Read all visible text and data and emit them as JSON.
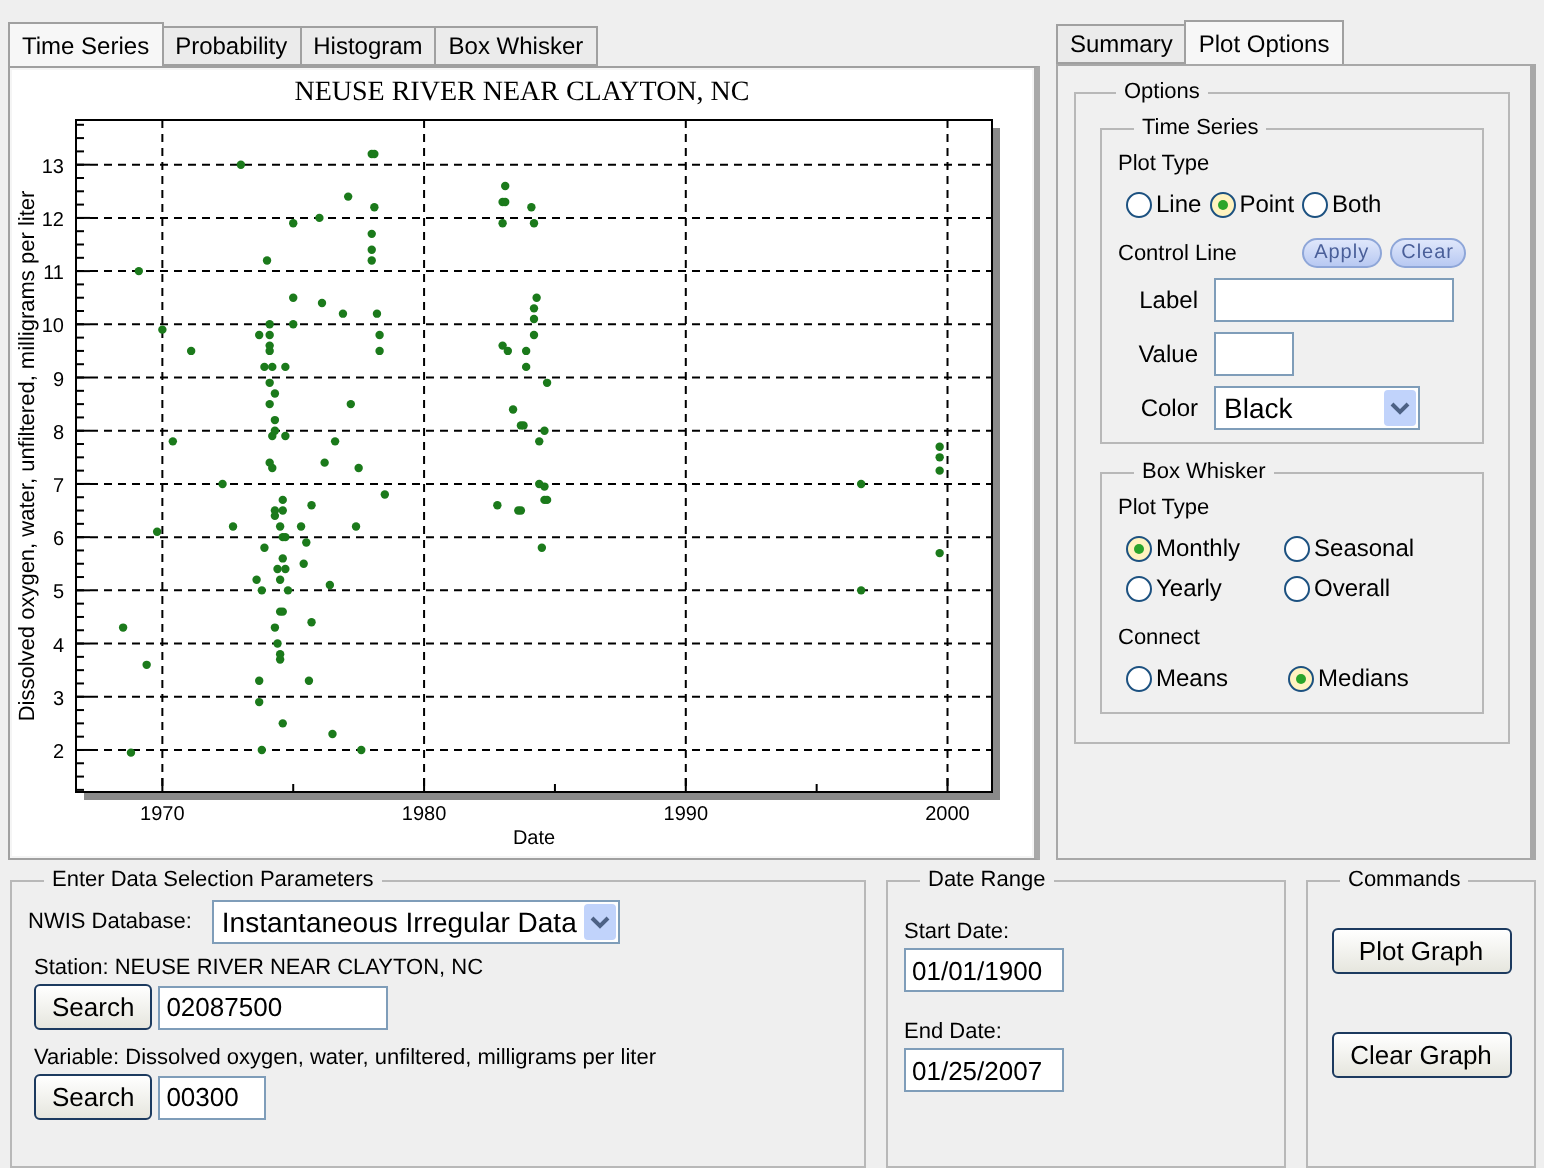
{
  "chart_tabs": [
    {
      "label": "Time Series",
      "selected": true
    },
    {
      "label": "Probability",
      "selected": false
    },
    {
      "label": "Histogram",
      "selected": false
    },
    {
      "label": "Box Whisker",
      "selected": false
    }
  ],
  "chart": {
    "chart_data": {
      "type": "scatter",
      "title": "NEUSE RIVER NEAR CLAYTON, NC",
      "xlabel": "Date",
      "ylabel": "Dissolved oxygen, water, unfiltered, milligrams per liter",
      "xlim": [
        1966.7,
        2001.7
      ],
      "ylim": [
        1.21,
        13.84
      ],
      "grid": true,
      "xticks": [
        1970,
        1980,
        1990,
        2000
      ],
      "yticks": [
        2,
        3,
        4,
        5,
        6,
        7,
        8,
        9,
        10,
        11,
        12,
        13
      ],
      "x": [
        1968.5,
        1968.8,
        1969.1,
        1969.4,
        1969.8,
        1970.0,
        1970.4,
        1971.1,
        1972.3,
        1972.7,
        1973.0,
        1973.8,
        1973.7,
        1973.7,
        1974.6,
        1974.5,
        1974.5,
        1974.4,
        1974.3,
        1974.5,
        1974.6,
        1974.8,
        1973.8,
        1973.6,
        1974.5,
        1974.4,
        1974.7,
        1974.6,
        1973.9,
        1974.6,
        1974.7,
        1974.5,
        1974.3,
        1974.3,
        1974.6,
        1974.6,
        1974.2,
        1974.1,
        1974.2,
        1974.7,
        1974.3,
        1974.3,
        1974.1,
        1974.3,
        1974.1,
        1973.9,
        1974.2,
        1974.7,
        1974.1,
        1974.1,
        1974.1,
        1973.7,
        1974.1,
        1974.0,
        1975.4,
        1975.5,
        1975.3,
        1975.7,
        1975.6,
        1975.7,
        1975.0,
        1975.0,
        1975.0,
        1976.0,
        1976.1,
        1976.2,
        1976.4,
        1976.5,
        1976.6,
        1976.9,
        1977.1,
        1977.2,
        1977.4,
        1977.5,
        1977.6,
        1978.0,
        1978.1,
        1978.1,
        1978.0,
        1978.0,
        1978.0,
        1978.2,
        1978.3,
        1978.3,
        1978.5,
        1982.8,
        1983.0,
        1983.2,
        1983.0,
        1983.1,
        1983.1,
        1983.0,
        1983.4,
        1983.6,
        1983.7,
        1984.1,
        1984.2,
        1984.3,
        1984.2,
        1984.2,
        1984.2,
        1983.9,
        1983.9,
        1984.7,
        1983.8,
        1984.6,
        1984.4,
        1984.4,
        1984.6,
        1984.6,
        1984.7,
        1983.7,
        1984.5,
        1996.7,
        1996.7,
        1999.7,
        1999.7,
        1999.7,
        1999.7
      ],
      "series": [
        {
          "color": "#1b7a1b",
          "values": [
            4.3,
            1.95,
            11.0,
            3.6,
            6.1,
            9.9,
            7.8,
            9.5,
            7.0,
            6.2,
            13.0,
            2.0,
            2.9,
            3.3,
            2.5,
            3.7,
            3.8,
            4.0,
            4.3,
            4.6,
            4.6,
            5.0,
            5.0,
            5.2,
            5.2,
            5.4,
            5.4,
            5.6,
            5.8,
            6.0,
            6.0,
            6.2,
            6.4,
            6.5,
            6.5,
            6.7,
            7.3,
            7.4,
            7.9,
            7.9,
            8.0,
            8.2,
            8.5,
            8.7,
            8.9,
            9.2,
            9.2,
            9.2,
            9.5,
            9.6,
            9.8,
            9.8,
            10.0,
            11.2,
            5.5,
            5.9,
            6.2,
            4.4,
            3.3,
            6.6,
            10.0,
            10.5,
            11.9,
            12.0,
            10.4,
            7.4,
            5.1,
            2.3,
            7.8,
            10.2,
            12.4,
            8.5,
            6.2,
            7.3,
            2.0,
            13.2,
            13.2,
            12.2,
            11.7,
            11.4,
            11.2,
            10.2,
            9.8,
            9.5,
            6.8,
            6.6,
            9.6,
            9.5,
            12.3,
            12.3,
            12.6,
            11.9,
            8.4,
            6.5,
            8.1,
            12.2,
            11.9,
            10.5,
            10.3,
            10.1,
            9.8,
            9.5,
            9.2,
            8.9,
            8.1,
            8.0,
            7.8,
            7.0,
            6.95,
            6.7,
            6.7,
            6.5,
            5.8,
            7.0,
            5.0,
            7.7,
            7.5,
            7.25,
            5.7
          ]
        }
      ]
    }
  },
  "side_tabs": [
    {
      "label": "Summary",
      "selected": false
    },
    {
      "label": "Plot Options",
      "selected": true
    }
  ],
  "options": {
    "legend": "Options",
    "time_series": {
      "legend": "Time Series",
      "plot_type_label": "Plot Type",
      "plot_types": [
        {
          "label": "Line",
          "selected": false
        },
        {
          "label": "Point",
          "selected": true
        },
        {
          "label": "Both",
          "selected": false
        }
      ],
      "control_line_label": "Control Line",
      "apply": "Apply",
      "clear": "Clear",
      "label_label": "Label",
      "value_label": "Value",
      "color_label": "Color",
      "color_value": "Black"
    },
    "box_whisker": {
      "legend": "Box Whisker",
      "plot_type_label": "Plot Type",
      "plot_types": [
        {
          "label": "Monthly",
          "selected": true
        },
        {
          "label": "Seasonal",
          "selected": false
        },
        {
          "label": "Yearly",
          "selected": false
        },
        {
          "label": "Overall",
          "selected": false
        }
      ],
      "connect_label": "Connect",
      "connect": [
        {
          "label": "Means",
          "selected": false
        },
        {
          "label": "Medians",
          "selected": true
        }
      ]
    }
  },
  "data_selection": {
    "legend": "Enter Data Selection Parameters",
    "database_label": "NWIS Database:",
    "database": "Instantaneous Irregular Data",
    "station_label": "Station: NEUSE RIVER NEAR CLAYTON, NC",
    "station_button": "Search",
    "station_value": "02087500",
    "variable_label": "Variable: Dissolved oxygen, water, unfiltered, milligrams per liter",
    "variable_button": "Search",
    "variable_value": "00300"
  },
  "date_range": {
    "legend": "Date Range",
    "start_label": "Start Date:",
    "start_value": "01/01/1900",
    "end_label": "End Date:",
    "end_value": "01/25/2007"
  },
  "commands": {
    "legend": "Commands",
    "buttons": [
      "Plot Graph",
      "Clear Graph"
    ]
  }
}
